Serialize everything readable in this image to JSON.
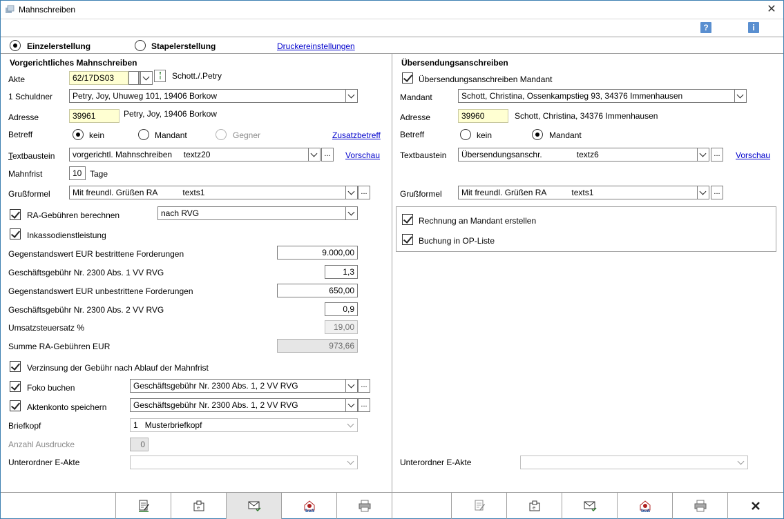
{
  "window": {
    "title": "Mahnschreiben"
  },
  "mode": {
    "single_label": "Einzelerstellung",
    "batch_label": "Stapelerstellung",
    "printer_link": "Druckereinstellungen",
    "selected": "single"
  },
  "left": {
    "section_title": "Vorgerichtliches Mahnschreiben",
    "akte": {
      "label": "Akte",
      "value": "62/17DS03",
      "desc": "Schott./.Petry"
    },
    "schuldner": {
      "label": "1 Schuldner",
      "value": "Petry, Joy, Uhuweg 101, 19406 Borkow"
    },
    "adresse": {
      "label": "Adresse",
      "value": "39961",
      "desc": "Petry, Joy, 19406 Borkow"
    },
    "betreff": {
      "label": "Betreff",
      "opt1": "kein",
      "opt2": "Mandant",
      "opt3": "Gegner",
      "link": "Zusatzbetreff",
      "selected": "kein"
    },
    "textbaustein": {
      "label": "Textbaustein",
      "value": "vorgerichtl. Mahnschreiben",
      "code": "textz20",
      "link": "Vorschau"
    },
    "mahnfrist": {
      "label": "Mahnfrist",
      "value": "10",
      "unit": "Tage"
    },
    "grussformel": {
      "label": "Grußformel",
      "value": "Mit freundl. Grüßen RA",
      "code": "texts1"
    },
    "ra_gebuehren": {
      "label": "RA-Gebühren berechnen",
      "checked": true,
      "select": "nach RVG"
    },
    "inkasso": {
      "label": "Inkassodienstleistung",
      "checked": true
    },
    "rows": [
      {
        "label": "Gegenstandswert EUR bestrittene Forderungen",
        "value": "9.000,00"
      },
      {
        "label": "Geschäftsgebühr Nr. 2300 Abs. 1 VV RVG",
        "value": "1,3"
      },
      {
        "label": "Gegenstandswert EUR unbestrittene Forderungen",
        "value": "650,00"
      },
      {
        "label": "Geschäftsgebühr Nr. 2300 Abs. 2 VV RVG",
        "value": "0,9"
      },
      {
        "label": "Umsatzsteuersatz %",
        "value": "19,00"
      },
      {
        "label": "Summe RA-Gebühren EUR",
        "value": "973,66"
      }
    ],
    "verzinsung": {
      "label": "Verzinsung der Gebühr nach Ablauf der Mahnfrist",
      "checked": true
    },
    "foko": {
      "label": "Foko buchen",
      "checked": true,
      "value": "Geschäftsgebühr Nr. 2300 Abs. 1, 2 VV RVG"
    },
    "aktenkonto": {
      "label": "Aktenkonto speichern",
      "checked": true,
      "value": "Geschäftsgebühr Nr. 2300 Abs. 1, 2 VV RVG"
    },
    "briefkopf": {
      "label": "Briefkopf",
      "num": "1",
      "value": "Musterbriefkopf"
    },
    "ausdrucke": {
      "label": "Anzahl Ausdrucke",
      "value": "0"
    },
    "unterordner": {
      "label": "Unterordner E-Akte",
      "value": ""
    }
  },
  "right": {
    "section_title": "Übersendungsanschreiben",
    "uebersendung": {
      "label": "Übersendungsanschreiben Mandant",
      "checked": true
    },
    "mandant": {
      "label": "Mandant",
      "value": "Schott, Christina, Ossenkampstieg 93, 34376 Immenhausen"
    },
    "adresse": {
      "label": "Adresse",
      "value": "39960",
      "desc": "Schott, Christina, 34376 Immenhausen"
    },
    "betreff": {
      "label": "Betreff",
      "opt1": "kein",
      "opt2": "Mandant",
      "selected": "Mandant"
    },
    "textbaustein": {
      "label": "Textbaustein",
      "value": "Übersendungsanschr.",
      "code": "textz6",
      "link": "Vorschau"
    },
    "grussformel": {
      "label": "Grußformel",
      "value": "Mit freundl. Grüßen RA",
      "code": "texts1"
    },
    "rechnung": {
      "label": "Rechnung an Mandant erstellen",
      "checked": true
    },
    "buchung": {
      "label": "Buchung in OP-Liste",
      "checked": true
    },
    "unterordner": {
      "label": "Unterordner E-Akte",
      "value": ""
    }
  },
  "toolbar": {
    "icons": [
      "edit-document-icon",
      "save-to-eakte-icon",
      "email-icon",
      "bea-icon",
      "print-icon",
      "edit-document-icon",
      "save-to-eakte-icon",
      "email-icon",
      "bea-icon",
      "print-icon",
      "close-icon"
    ]
  }
}
